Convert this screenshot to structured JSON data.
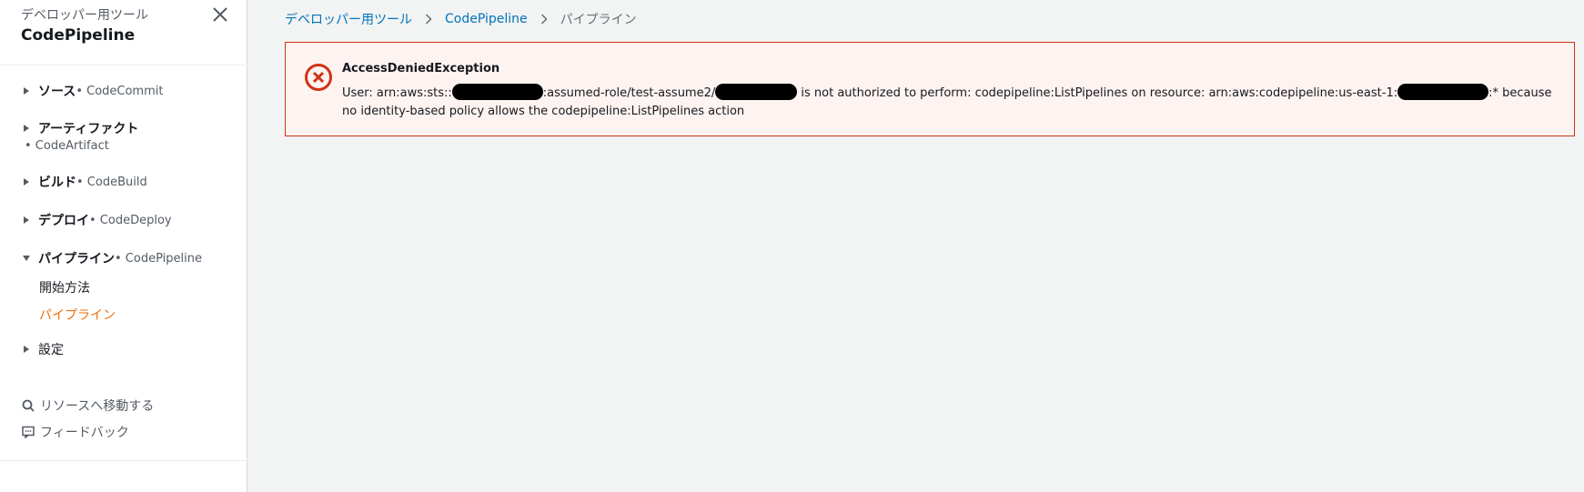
{
  "sidebar": {
    "supertitle": "デベロッパー用ツール",
    "title": "CodePipeline",
    "sections": [
      {
        "label": "ソース",
        "sub": " • CodeCommit"
      },
      {
        "label": "アーティファクト",
        "sub": "• CodeArtifact"
      },
      {
        "label": "ビルド",
        "sub": " • CodeBuild"
      },
      {
        "label": "デプロイ",
        "sub": " • CodeDeploy"
      },
      {
        "label": "パイプライン",
        "sub": " • CodePipeline"
      },
      {
        "label": "設定",
        "sub": ""
      }
    ],
    "pipeline_children": [
      "開始方法",
      "パイプライン"
    ],
    "utilities": [
      "リソースへ移動する",
      "フィードバック"
    ]
  },
  "breadcrumb": {
    "items": [
      "デベロッパー用ツール",
      "CodePipeline",
      "パイプライン"
    ]
  },
  "alert": {
    "title": "AccessDeniedException",
    "body_parts": [
      "User: arn:aws:sts::",
      ":assumed-role/test-assume2/",
      " is not authorized to perform: codepipeline:ListPipelines on resource: arn:aws:codepipeline:us-east-1:",
      ":* because no identity-based policy allows the codepipeline:ListPipelines action"
    ]
  },
  "colors": {
    "accent_active": "#ec7211",
    "link": "#0073bb",
    "error": "#d13212",
    "error_bg": "#fdf3f1"
  }
}
